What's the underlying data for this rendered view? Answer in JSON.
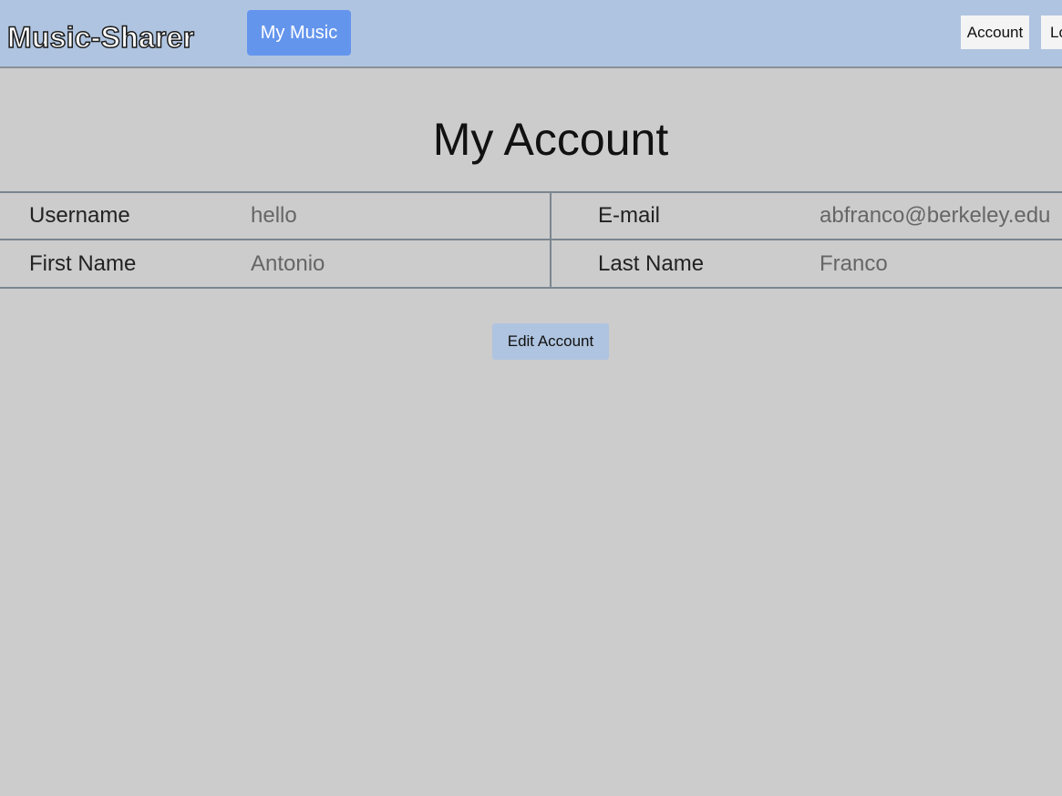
{
  "navbar": {
    "brand": "Music-Sharer",
    "my_music_label": "My Music",
    "account_label": "Account",
    "logout_label": "Lo"
  },
  "page": {
    "title": "My Account"
  },
  "account_table": {
    "rows": [
      {
        "left": {
          "label": "Username",
          "value": "hello"
        },
        "right": {
          "label": "E-mail",
          "value": "abfranco@berkeley.edu"
        }
      },
      {
        "left": {
          "label": "First Name",
          "value": "Antonio"
        },
        "right": {
          "label": "Last Name",
          "value": "Franco"
        }
      }
    ]
  },
  "actions": {
    "edit_label": "Edit Account"
  },
  "colors": {
    "navbar_bg": "#afc4e0",
    "page_bg": "#cccccc",
    "accent": "#6495ed"
  }
}
